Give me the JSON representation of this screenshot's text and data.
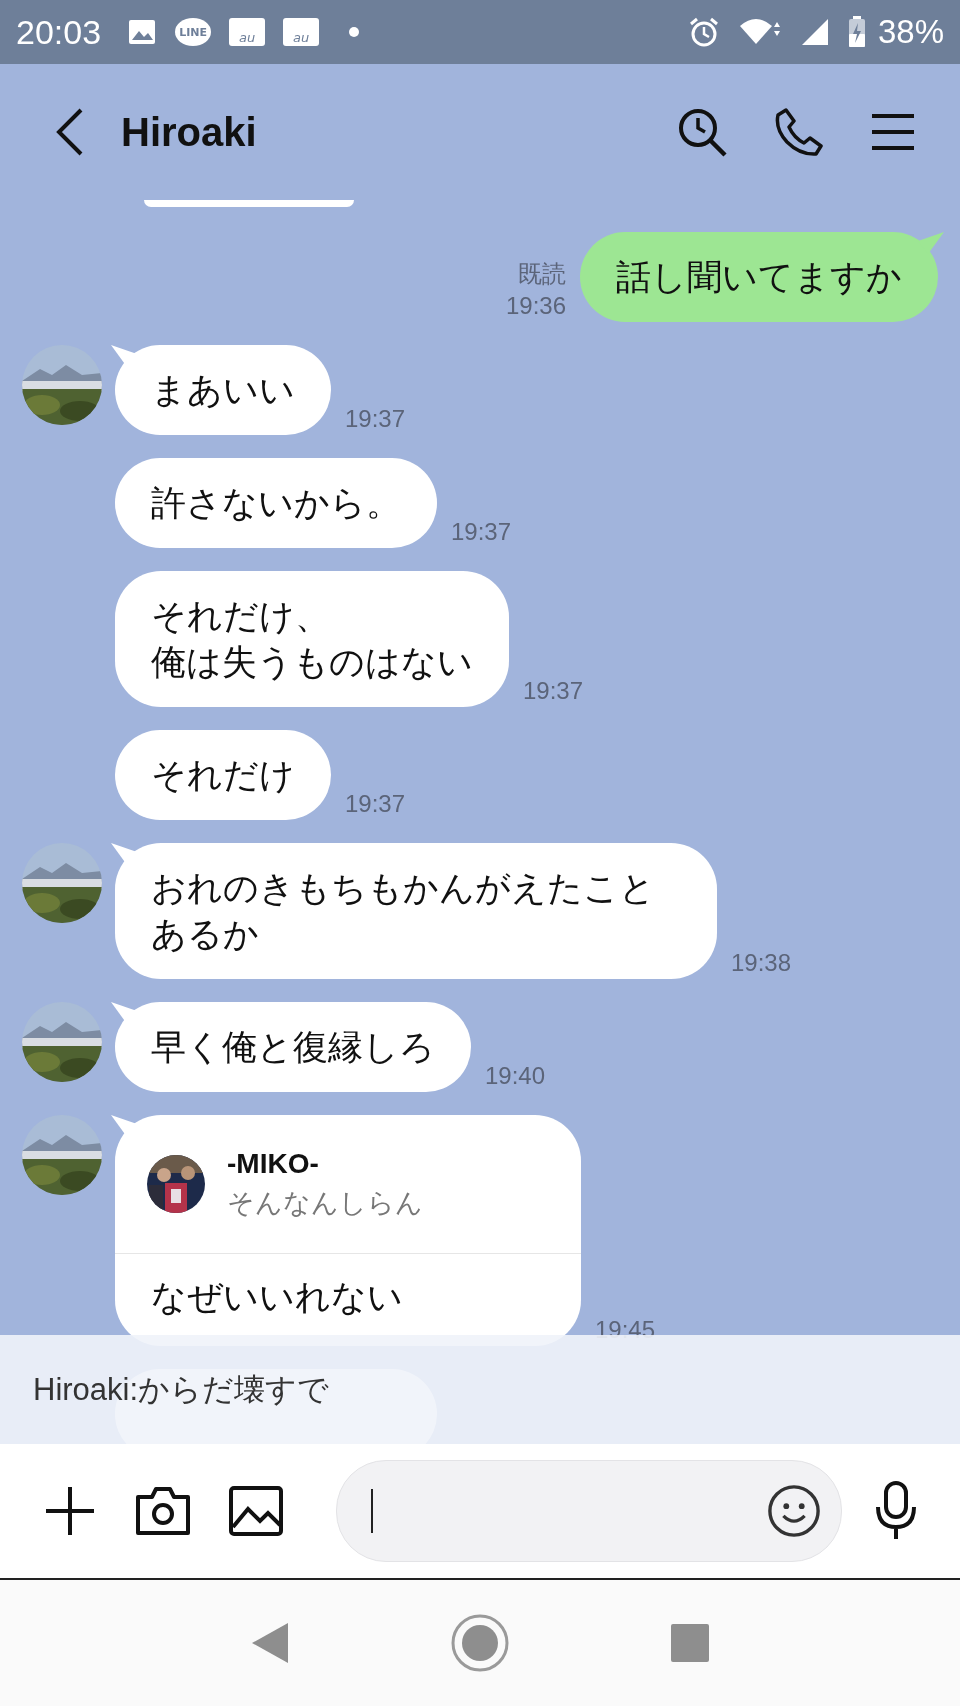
{
  "status_bar": {
    "time": "20:03",
    "notification_icons": [
      {
        "kind": "gallery"
      },
      {
        "kind": "chat",
        "label": "LINE"
      },
      {
        "kind": "mail",
        "label": "au"
      },
      {
        "kind": "mail",
        "label": "au"
      },
      {
        "kind": "dot"
      }
    ],
    "battery": "38%"
  },
  "header": {
    "title": "Hiroaki"
  },
  "messages": [
    {
      "kind": "sent",
      "text": "話し聞いてますか",
      "read": "既読",
      "time": "19:36"
    },
    {
      "kind": "received",
      "avatar": true,
      "text": "まあいい",
      "time": "19:37"
    },
    {
      "kind": "received",
      "avatar": false,
      "text": "許さないから。",
      "time": "19:37"
    },
    {
      "kind": "received",
      "avatar": false,
      "lines": [
        "それだけ、",
        "俺は失うものはない"
      ],
      "time": "19:37"
    },
    {
      "kind": "received",
      "avatar": false,
      "text": "それだけ",
      "time": "19:37"
    },
    {
      "kind": "received",
      "avatar": true,
      "text": "おれのきもちもかんがえたことあるか",
      "time": "19:38"
    },
    {
      "kind": "received",
      "avatar": true,
      "text": "早く俺と復縁しろ",
      "time": "19:40"
    },
    {
      "kind": "reply",
      "avatar": true,
      "quote_name": "-MIKO-",
      "quote_text": "そんなんしらん",
      "text": "なぜいいれない",
      "time": "19:45"
    },
    {
      "kind": "received",
      "avatar": false
    }
  ],
  "notification": {
    "text": "Hiroaki:からだ壊すで"
  }
}
